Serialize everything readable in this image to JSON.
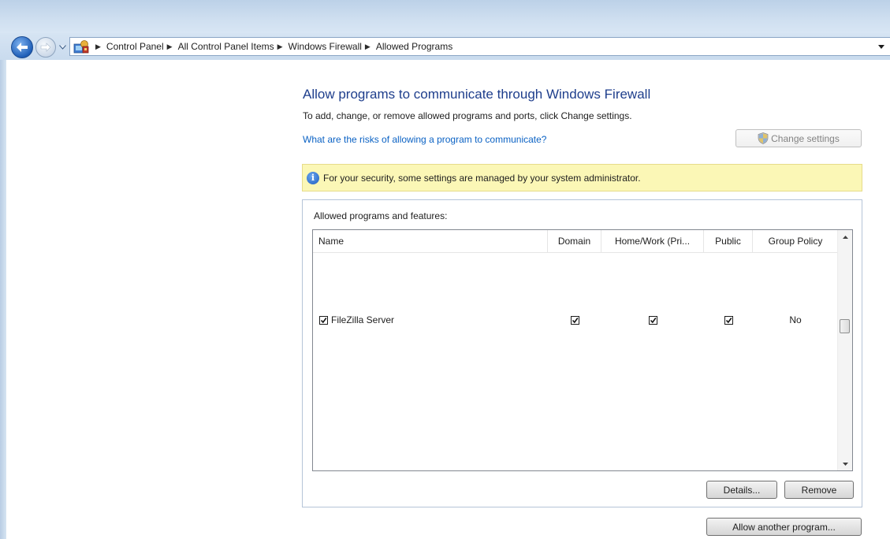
{
  "address_bar": {
    "breadcrumbs": [
      "Control Panel",
      "All Control Panel Items",
      "Windows Firewall",
      "Allowed Programs"
    ]
  },
  "main": {
    "title": "Allow programs to communicate through Windows Firewall",
    "subtitle": "To add, change, or remove allowed programs and ports, click Change settings.",
    "risk_link": "What are the risks of allowing a program to communicate?",
    "change_settings_label": "Change settings",
    "info_message": "For your security, some settings are managed by your system administrator."
  },
  "programs": {
    "group_label": "Allowed programs and features:",
    "columns": [
      "Name",
      "Domain",
      "Home/Work (Pri...",
      "Public",
      "Group Policy"
    ],
    "rows": [
      {
        "name": "FileZilla Server",
        "enabled": true,
        "domain": true,
        "home_work": true,
        "public": true,
        "group_policy": "No"
      }
    ],
    "details_label": "Details...",
    "remove_label": "Remove"
  },
  "allow_another_label": "Allow another program...",
  "colors": {
    "title": "#1e3e8c",
    "link": "#0b62c4",
    "info_background": "#fbf7b6"
  }
}
